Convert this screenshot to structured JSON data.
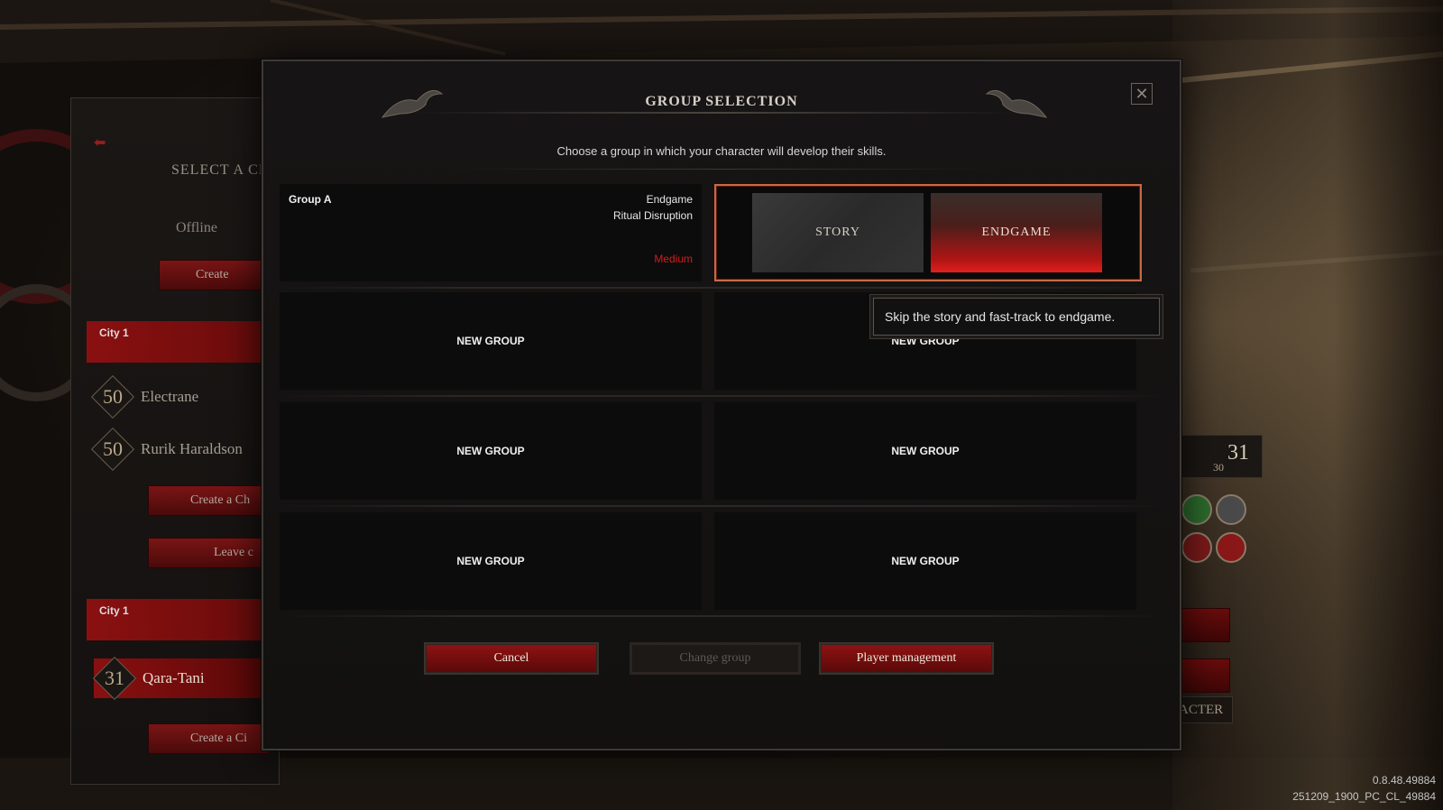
{
  "background": {
    "left_panel": {
      "title": "SELECT A CH",
      "mode": "Offline",
      "create_button": "Create",
      "cities": [
        {
          "label": "City 1",
          "characters": [
            {
              "level": "50",
              "name": "Electrane"
            },
            {
              "level": "50",
              "name": "Rurik Haraldson"
            }
          ],
          "buttons": [
            "Create a Ch",
            "Leave c"
          ]
        },
        {
          "label": "City 1",
          "characters": [
            {
              "level": "31",
              "name": "Qara-Tani"
            }
          ],
          "buttons": [
            "Create a Ci"
          ]
        }
      ]
    },
    "right_panel": {
      "level_big": "31",
      "level_small": "30",
      "character_button": "RACTER"
    },
    "version": {
      "line1": "0.8.48.49884",
      "line2": "251209_1900_PC_CL_49884"
    }
  },
  "modal": {
    "title": "GROUP SELECTION",
    "subtitle": "Choose a group in which your character will develop their skills.",
    "group_a": {
      "name": "Group A",
      "mode": "Endgame",
      "activity": "Ritual Disruption",
      "difficulty": "Medium"
    },
    "mode_options": {
      "story": "STORY",
      "endgame": "ENDGAME",
      "selected": "ENDGAME"
    },
    "tooltip": "Skip the story and fast-track to endgame.",
    "new_group_label": "NEW GROUP",
    "buttons": {
      "cancel": "Cancel",
      "change_group": "Change group",
      "player_management": "Player management"
    },
    "close_icon": "close-icon"
  },
  "colors": {
    "accent_red": "#8d1313",
    "difficulty_red": "#d21d1d",
    "selection_frame": "#c86a45"
  }
}
